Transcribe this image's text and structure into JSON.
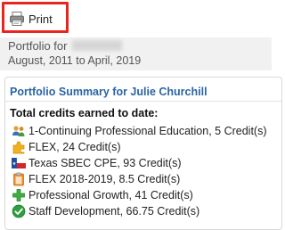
{
  "toolbar": {
    "print_label": "Print"
  },
  "header": {
    "title": "Portfolio for",
    "dates": "August, 2011 to April, 2019"
  },
  "summary": {
    "title": "Portfolio Summary for Julie Churchill",
    "total_label": "Total credits earned to date:",
    "items": [
      {
        "icon": "people-icon",
        "label": "1-Continuing Professional Education, 5 Credit(s)"
      },
      {
        "icon": "puzzle-icon",
        "label": "FLEX, 24 Credit(s)"
      },
      {
        "icon": "texas-flag-icon",
        "label": "Texas SBEC CPE, 93 Credit(s)"
      },
      {
        "icon": "clipboard-icon",
        "label": "FLEX 2018-2019, 8.5 Credit(s)"
      },
      {
        "icon": "plus-icon",
        "label": "Professional Growth, 41 Credit(s)"
      },
      {
        "icon": "check-circle-icon",
        "label": "Staff Development, 66.75 Credit(s)"
      }
    ]
  },
  "colors": {
    "highlight": "#e8261e",
    "title_blue": "#2a64a6"
  }
}
